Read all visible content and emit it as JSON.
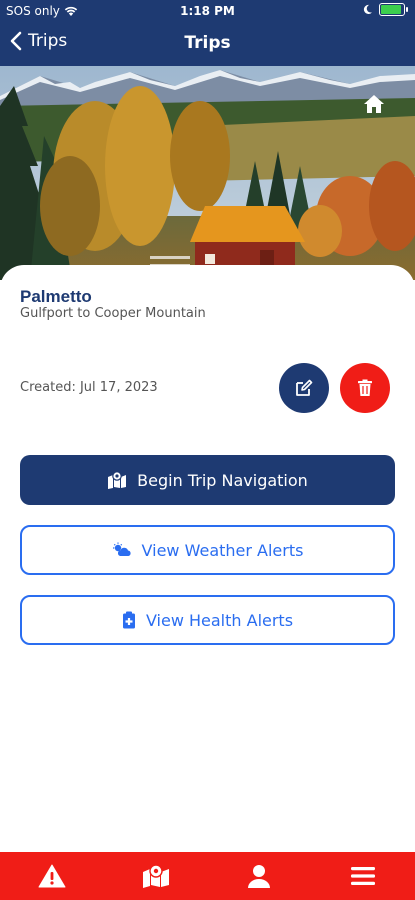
{
  "status_bar": {
    "carrier": "SOS only",
    "time": "1:18 PM",
    "battery_level": 0.9,
    "icons": [
      "wifi-icon",
      "moon-icon",
      "battery-icon"
    ]
  },
  "nav": {
    "back_label": "Trips",
    "title": "Trips"
  },
  "trip": {
    "name": "Palmetto",
    "route": "Gulfport to Cooper Mountain",
    "created": "Created: Jul 17, 2023"
  },
  "actions": {
    "begin_navigation": "Begin Trip Navigation",
    "weather_alerts": "View Weather Alerts",
    "health_alerts": "View Health Alerts"
  },
  "tabs": [
    {
      "icon": "warning-icon"
    },
    {
      "icon": "map-icon"
    },
    {
      "icon": "user-icon"
    },
    {
      "icon": "menu-icon"
    }
  ],
  "colors": {
    "primary": "#1e3a72",
    "accent": "#2a6df0",
    "danger": "#f01d17"
  }
}
